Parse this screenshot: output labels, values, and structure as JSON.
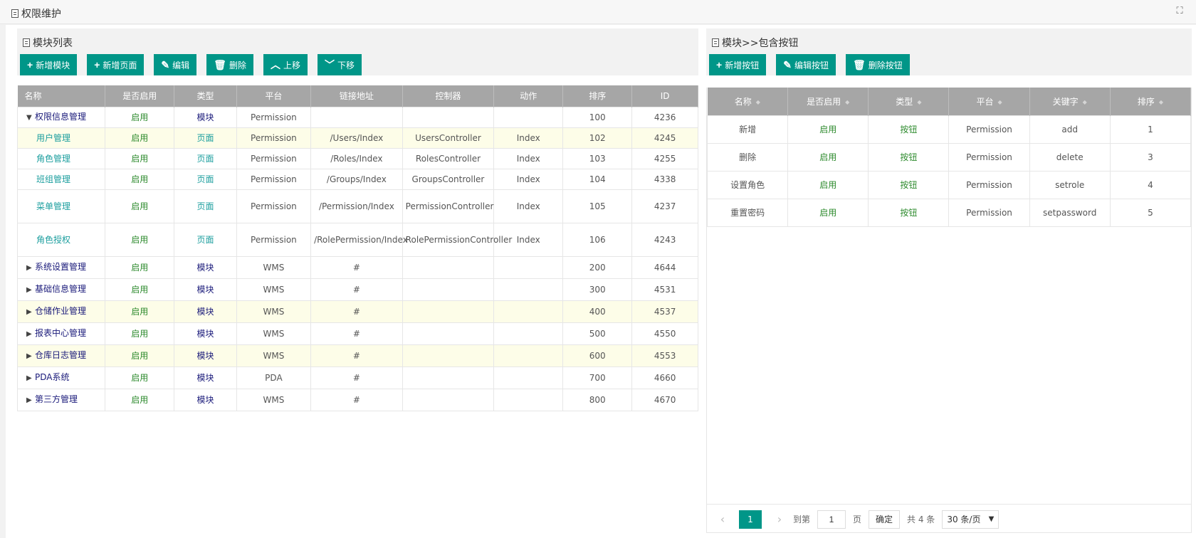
{
  "header": {
    "title": "权限维护",
    "expand_icon": "expand-icon"
  },
  "left": {
    "title": "模块列表",
    "toolbar": [
      {
        "label": "新增模块",
        "icon": "+"
      },
      {
        "label": "新增页面",
        "icon": "+"
      },
      {
        "label": "编辑",
        "icon": "✎"
      },
      {
        "label": "删除",
        "icon": "🗑"
      },
      {
        "label": "上移",
        "icon": "︿"
      },
      {
        "label": "下移",
        "icon": "﹀"
      }
    ],
    "columns": [
      "名称",
      "是否启用",
      "类型",
      "平台",
      "链接地址",
      "控制器",
      "动作",
      "排序",
      "ID"
    ],
    "rows": [
      {
        "name": "权限信息管理",
        "kind": "module",
        "expanded": true,
        "enabled": "启用",
        "type": "模块",
        "platform": "Permission",
        "url": "",
        "controller": "",
        "action": "",
        "sort": "100",
        "id": "4236",
        "hl": false
      },
      {
        "name": "用户管理",
        "kind": "page",
        "enabled": "启用",
        "type": "页面",
        "platform": "Permission",
        "url": "/Users/Index",
        "controller": "UsersController",
        "action": "Index",
        "sort": "102",
        "id": "4245",
        "hl": true
      },
      {
        "name": "角色管理",
        "kind": "page",
        "enabled": "启用",
        "type": "页面",
        "platform": "Permission",
        "url": "/Roles/Index",
        "controller": "RolesController",
        "action": "Index",
        "sort": "103",
        "id": "4255",
        "hl": false
      },
      {
        "name": "班组管理",
        "kind": "page",
        "enabled": "启用",
        "type": "页面",
        "platform": "Permission",
        "url": "/Groups/Index",
        "controller": "GroupsController",
        "action": "Index",
        "sort": "104",
        "id": "4338",
        "hl": false
      },
      {
        "name": "菜单管理",
        "kind": "page",
        "enabled": "启用",
        "type": "页面",
        "platform": "Permission",
        "url": "/Permission/Index",
        "controller": "PermissionController",
        "action": "Index",
        "sort": "105",
        "id": "4237",
        "hl": false,
        "tall": true
      },
      {
        "name": "角色授权",
        "kind": "page",
        "enabled": "启用",
        "type": "页面",
        "platform": "Permission",
        "url": "/RolePermission/Index",
        "controller": "RolePermissionController",
        "action": "Index",
        "sort": "106",
        "id": "4243",
        "hl": false,
        "tall": true
      },
      {
        "name": "系统设置管理",
        "kind": "module",
        "expanded": false,
        "enabled": "启用",
        "type": "模块",
        "platform": "WMS",
        "url": "#",
        "controller": "",
        "action": "",
        "sort": "200",
        "id": "4644",
        "hl": false
      },
      {
        "name": "基础信息管理",
        "kind": "module",
        "expanded": false,
        "enabled": "启用",
        "type": "模块",
        "platform": "WMS",
        "url": "#",
        "controller": "",
        "action": "",
        "sort": "300",
        "id": "4531",
        "hl": false
      },
      {
        "name": "仓储作业管理",
        "kind": "module",
        "expanded": false,
        "enabled": "启用",
        "type": "模块",
        "platform": "WMS",
        "url": "#",
        "controller": "",
        "action": "",
        "sort": "400",
        "id": "4537",
        "hl": true
      },
      {
        "name": "报表中心管理",
        "kind": "module",
        "expanded": false,
        "enabled": "启用",
        "type": "模块",
        "platform": "WMS",
        "url": "#",
        "controller": "",
        "action": "",
        "sort": "500",
        "id": "4550",
        "hl": false
      },
      {
        "name": "仓库日志管理",
        "kind": "module",
        "expanded": false,
        "enabled": "启用",
        "type": "模块",
        "platform": "WMS",
        "url": "#",
        "controller": "",
        "action": "",
        "sort": "600",
        "id": "4553",
        "hl": true
      },
      {
        "name": "PDA系统",
        "kind": "module",
        "expanded": false,
        "enabled": "启用",
        "type": "模块",
        "platform": "PDA",
        "url": "#",
        "controller": "",
        "action": "",
        "sort": "700",
        "id": "4660",
        "hl": false
      },
      {
        "name": "第三方管理",
        "kind": "module",
        "expanded": false,
        "enabled": "启用",
        "type": "模块",
        "platform": "WMS",
        "url": "#",
        "controller": "",
        "action": "",
        "sort": "800",
        "id": "4670",
        "hl": false
      }
    ]
  },
  "right": {
    "title": "模块>>包含按钮",
    "toolbar": [
      {
        "label": "新增按钮",
        "icon": "+"
      },
      {
        "label": "编辑按钮",
        "icon": "✎"
      },
      {
        "label": "删除按钮",
        "icon": "🗑"
      }
    ],
    "columns": [
      "名称",
      "是否启用",
      "类型",
      "平台",
      "关键字",
      "排序"
    ],
    "rows": [
      {
        "name": "新增",
        "enabled": "启用",
        "type": "按钮",
        "platform": "Permission",
        "key": "add",
        "sort": "1"
      },
      {
        "name": "删除",
        "enabled": "启用",
        "type": "按钮",
        "platform": "Permission",
        "key": "delete",
        "sort": "3"
      },
      {
        "name": "设置角色",
        "enabled": "启用",
        "type": "按钮",
        "platform": "Permission",
        "key": "setrole",
        "sort": "4"
      },
      {
        "name": "重置密码",
        "enabled": "启用",
        "type": "按钮",
        "platform": "Permission",
        "key": "setpassword",
        "sort": "5"
      }
    ],
    "pager": {
      "prev": "‹",
      "next": "›",
      "current": "1",
      "goto_label": "到第",
      "goto_value": "1",
      "page_unit": "页",
      "ok_label": "确定",
      "total": "共 4 条",
      "page_size": "30 条/页"
    }
  },
  "colors": {
    "accent": "#009688",
    "header_gray": "#a6a6a6",
    "enabled_green": "#2e8b2e",
    "module_navy": "#1a1a7a",
    "page_teal": "#1b9e9e",
    "highlight": "#fdfde8"
  }
}
